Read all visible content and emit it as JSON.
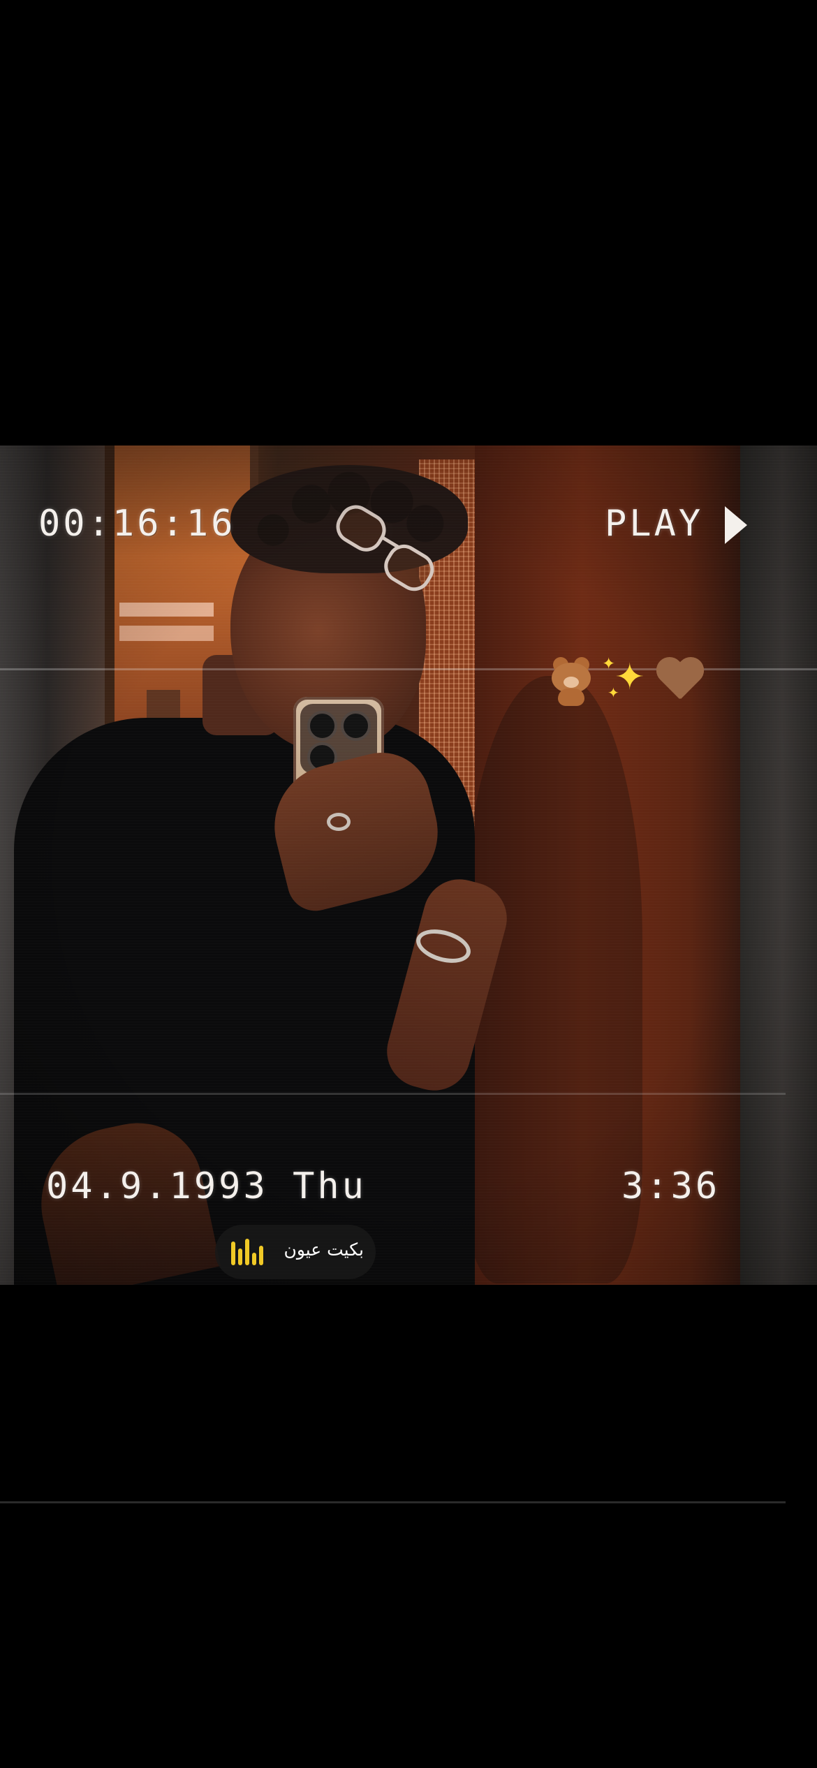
{
  "overlay": {
    "timecode": "00:16:16",
    "play_label": "PLAY",
    "date_label": "04.9.1993 Thu",
    "clock_label": "3:36"
  },
  "stickers": {
    "icons": [
      "teddy-bear-icon",
      "sparkles-icon",
      "brown-heart-icon"
    ]
  },
  "audio": {
    "title": "بكيت عيون",
    "icon": "audio-waveform-icon",
    "accent_color": "#f0c926"
  },
  "theme": {
    "background": "#000000",
    "text_color": "#f4f0ec"
  }
}
